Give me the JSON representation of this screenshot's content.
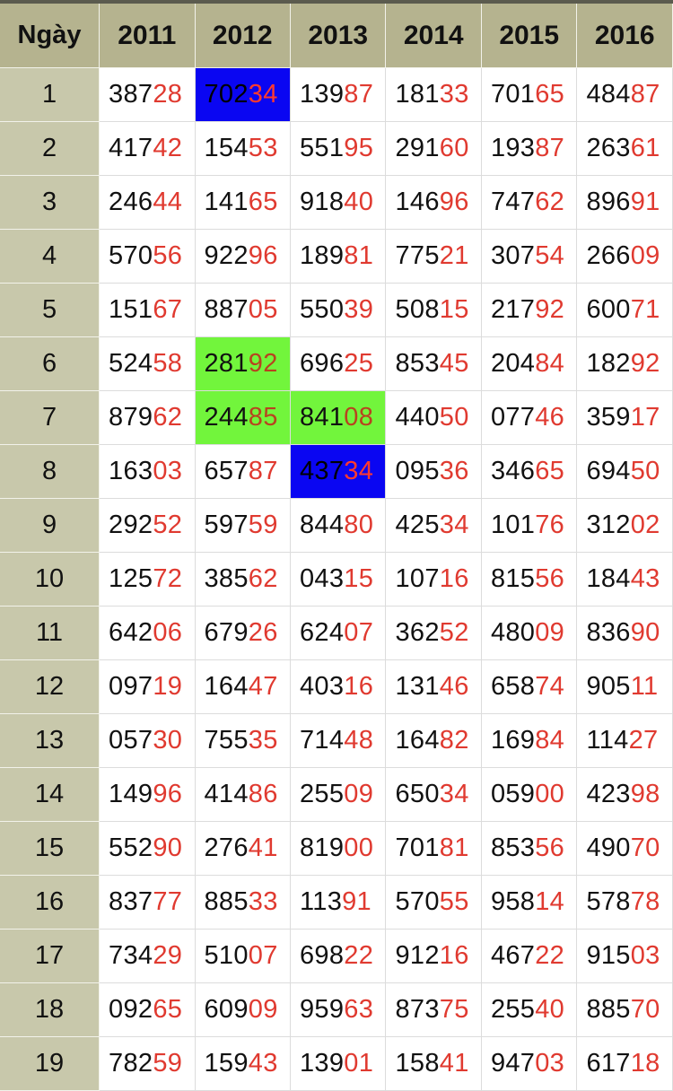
{
  "colors": {
    "header_bg": "#b5b38f",
    "day_cell_bg": "#c8c8ab",
    "tail_digits": "#e03a30",
    "highlight_blue": "#0a06f2",
    "highlight_green": "#72f53c"
  },
  "header": {
    "day_label": "Ngày",
    "years": [
      "2011",
      "2012",
      "2013",
      "2014",
      "2015",
      "2016"
    ]
  },
  "rows": [
    {
      "day": "1",
      "cells": [
        {
          "head": "387",
          "tail": "28"
        },
        {
          "head": "702",
          "tail": "34",
          "highlight": "blue"
        },
        {
          "head": "139",
          "tail": "87"
        },
        {
          "head": "181",
          "tail": "33"
        },
        {
          "head": "701",
          "tail": "65"
        },
        {
          "head": "484",
          "tail": "87"
        }
      ]
    },
    {
      "day": "2",
      "cells": [
        {
          "head": "417",
          "tail": "42"
        },
        {
          "head": "154",
          "tail": "53"
        },
        {
          "head": "551",
          "tail": "95"
        },
        {
          "head": "291",
          "tail": "60"
        },
        {
          "head": "193",
          "tail": "87"
        },
        {
          "head": "263",
          "tail": "61"
        }
      ]
    },
    {
      "day": "3",
      "cells": [
        {
          "head": "246",
          "tail": "44"
        },
        {
          "head": "141",
          "tail": "65"
        },
        {
          "head": "918",
          "tail": "40"
        },
        {
          "head": "146",
          "tail": "96"
        },
        {
          "head": "747",
          "tail": "62"
        },
        {
          "head": "896",
          "tail": "91"
        }
      ]
    },
    {
      "day": "4",
      "cells": [
        {
          "head": "570",
          "tail": "56"
        },
        {
          "head": "922",
          "tail": "96"
        },
        {
          "head": "189",
          "tail": "81"
        },
        {
          "head": "775",
          "tail": "21"
        },
        {
          "head": "307",
          "tail": "54"
        },
        {
          "head": "266",
          "tail": "09"
        }
      ]
    },
    {
      "day": "5",
      "cells": [
        {
          "head": "151",
          "tail": "67"
        },
        {
          "head": "887",
          "tail": "05"
        },
        {
          "head": "550",
          "tail": "39"
        },
        {
          "head": "508",
          "tail": "15"
        },
        {
          "head": "217",
          "tail": "92"
        },
        {
          "head": "600",
          "tail": "71"
        }
      ]
    },
    {
      "day": "6",
      "cells": [
        {
          "head": "524",
          "tail": "58"
        },
        {
          "head": "281",
          "tail": "92",
          "highlight": "green"
        },
        {
          "head": "696",
          "tail": "25"
        },
        {
          "head": "853",
          "tail": "45"
        },
        {
          "head": "204",
          "tail": "84"
        },
        {
          "head": "182",
          "tail": "92"
        }
      ]
    },
    {
      "day": "7",
      "cells": [
        {
          "head": "879",
          "tail": "62"
        },
        {
          "head": "244",
          "tail": "85",
          "highlight": "green"
        },
        {
          "head": "841",
          "tail": "08",
          "highlight": "green"
        },
        {
          "head": "440",
          "tail": "50"
        },
        {
          "head": "077",
          "tail": "46"
        },
        {
          "head": "359",
          "tail": "17"
        }
      ]
    },
    {
      "day": "8",
      "cells": [
        {
          "head": "163",
          "tail": "03"
        },
        {
          "head": "657",
          "tail": "87"
        },
        {
          "head": "437",
          "tail": "34",
          "highlight": "blue"
        },
        {
          "head": "095",
          "tail": "36"
        },
        {
          "head": "346",
          "tail": "65"
        },
        {
          "head": "694",
          "tail": "50"
        }
      ]
    },
    {
      "day": "9",
      "cells": [
        {
          "head": "292",
          "tail": "52"
        },
        {
          "head": "597",
          "tail": "59"
        },
        {
          "head": "844",
          "tail": "80"
        },
        {
          "head": "425",
          "tail": "34"
        },
        {
          "head": "101",
          "tail": "76"
        },
        {
          "head": "312",
          "tail": "02"
        }
      ]
    },
    {
      "day": "10",
      "cells": [
        {
          "head": "125",
          "tail": "72"
        },
        {
          "head": "385",
          "tail": "62"
        },
        {
          "head": "043",
          "tail": "15"
        },
        {
          "head": "107",
          "tail": "16"
        },
        {
          "head": "815",
          "tail": "56"
        },
        {
          "head": "184",
          "tail": "43"
        }
      ]
    },
    {
      "day": "11",
      "cells": [
        {
          "head": "642",
          "tail": "06"
        },
        {
          "head": "679",
          "tail": "26"
        },
        {
          "head": "624",
          "tail": "07"
        },
        {
          "head": "362",
          "tail": "52"
        },
        {
          "head": "480",
          "tail": "09"
        },
        {
          "head": "836",
          "tail": "90"
        }
      ]
    },
    {
      "day": "12",
      "cells": [
        {
          "head": "097",
          "tail": "19"
        },
        {
          "head": "164",
          "tail": "47"
        },
        {
          "head": "403",
          "tail": "16"
        },
        {
          "head": "131",
          "tail": "46"
        },
        {
          "head": "658",
          "tail": "74"
        },
        {
          "head": "905",
          "tail": "11"
        }
      ]
    },
    {
      "day": "13",
      "cells": [
        {
          "head": "057",
          "tail": "30"
        },
        {
          "head": "755",
          "tail": "35"
        },
        {
          "head": "714",
          "tail": "48"
        },
        {
          "head": "164",
          "tail": "82"
        },
        {
          "head": "169",
          "tail": "84"
        },
        {
          "head": "114",
          "tail": "27"
        }
      ]
    },
    {
      "day": "14",
      "cells": [
        {
          "head": "149",
          "tail": "96"
        },
        {
          "head": "414",
          "tail": "86"
        },
        {
          "head": "255",
          "tail": "09"
        },
        {
          "head": "650",
          "tail": "34"
        },
        {
          "head": "059",
          "tail": "00"
        },
        {
          "head": "423",
          "tail": "98"
        }
      ]
    },
    {
      "day": "15",
      "cells": [
        {
          "head": "552",
          "tail": "90"
        },
        {
          "head": "276",
          "tail": "41"
        },
        {
          "head": "819",
          "tail": "00"
        },
        {
          "head": "701",
          "tail": "81"
        },
        {
          "head": "853",
          "tail": "56"
        },
        {
          "head": "490",
          "tail": "70"
        }
      ]
    },
    {
      "day": "16",
      "cells": [
        {
          "head": "837",
          "tail": "77"
        },
        {
          "head": "885",
          "tail": "33"
        },
        {
          "head": "113",
          "tail": "91"
        },
        {
          "head": "570",
          "tail": "55"
        },
        {
          "head": "958",
          "tail": "14"
        },
        {
          "head": "578",
          "tail": "78"
        }
      ]
    },
    {
      "day": "17",
      "cells": [
        {
          "head": "734",
          "tail": "29"
        },
        {
          "head": "510",
          "tail": "07"
        },
        {
          "head": "698",
          "tail": "22"
        },
        {
          "head": "912",
          "tail": "16"
        },
        {
          "head": "467",
          "tail": "22"
        },
        {
          "head": "915",
          "tail": "03"
        }
      ]
    },
    {
      "day": "18",
      "cells": [
        {
          "head": "092",
          "tail": "65"
        },
        {
          "head": "609",
          "tail": "09"
        },
        {
          "head": "959",
          "tail": "63"
        },
        {
          "head": "873",
          "tail": "75"
        },
        {
          "head": "255",
          "tail": "40"
        },
        {
          "head": "885",
          "tail": "70"
        }
      ]
    },
    {
      "day": "19",
      "cells": [
        {
          "head": "782",
          "tail": "59"
        },
        {
          "head": "159",
          "tail": "43"
        },
        {
          "head": "139",
          "tail": "01"
        },
        {
          "head": "158",
          "tail": "41"
        },
        {
          "head": "947",
          "tail": "03"
        },
        {
          "head": "617",
          "tail": "18"
        }
      ]
    }
  ]
}
